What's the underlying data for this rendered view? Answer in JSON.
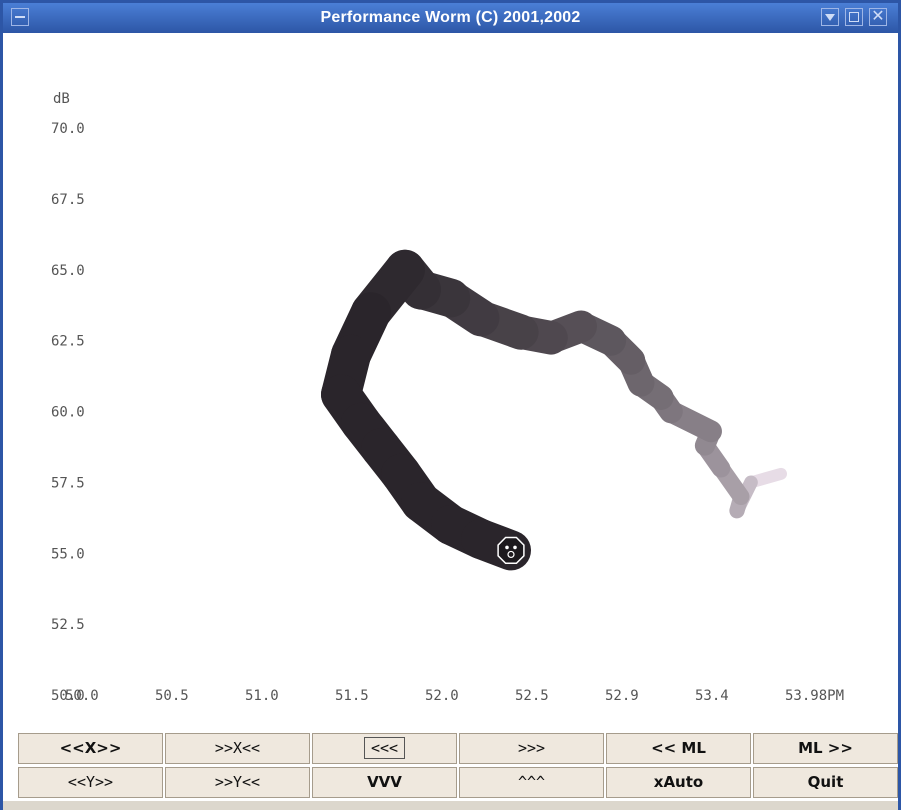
{
  "window": {
    "title": "Performance Worm    (C) 2001,2002"
  },
  "chart_data": {
    "type": "line",
    "title": "",
    "xlabel": "",
    "ylabel": "dB",
    "xlim": [
      50.0,
      54.0
    ],
    "ylim": [
      50.0,
      70.0
    ],
    "x_ticks": [
      "50.0",
      "50.5",
      "51.0",
      "51.5",
      "52.0",
      "52.5",
      "52.9",
      "53.4",
      "53.98PM"
    ],
    "y_ticks": [
      "70.0",
      "67.5",
      "65.0",
      "62.5",
      "60.0",
      "57.5",
      "55.0",
      "52.5",
      "50.0"
    ],
    "grid": false,
    "series": [
      {
        "x": [
          53.6,
          53.45,
          53.38,
          53.4,
          53.3,
          53.22,
          53.25,
          53.05,
          53.0,
          52.9,
          52.85,
          52.75,
          52.6,
          52.45,
          52.3,
          52.1,
          51.95,
          51.8,
          51.72,
          51.55,
          51.45,
          51.4,
          51.5,
          51.6,
          51.7,
          51.8,
          51.95,
          52.1,
          52.25
        ],
        "y": [
          57.8,
          57.5,
          56.5,
          57.0,
          58.0,
          58.8,
          59.3,
          60.0,
          60.5,
          61.0,
          61.8,
          62.5,
          63.0,
          62.6,
          62.8,
          63.3,
          64.0,
          64.3,
          65.0,
          63.5,
          62.0,
          60.6,
          59.6,
          58.7,
          57.8,
          56.8,
          56.0,
          55.5,
          55.1
        ]
      }
    ]
  },
  "buttons": {
    "row1": [
      "<<X>>",
      ">>X<<",
      "<<<",
      ">>>",
      "<< ML",
      "ML >>"
    ],
    "row2": [
      "<<Y>>",
      ">>Y<<",
      "VVV",
      "^^^",
      "xAuto",
      "Quit"
    ]
  },
  "colors": {
    "titlebar": "#2d56a6",
    "worm_head": "#2a252b",
    "worm_tail": "#e7dce6",
    "button_face": "#efe8de"
  }
}
